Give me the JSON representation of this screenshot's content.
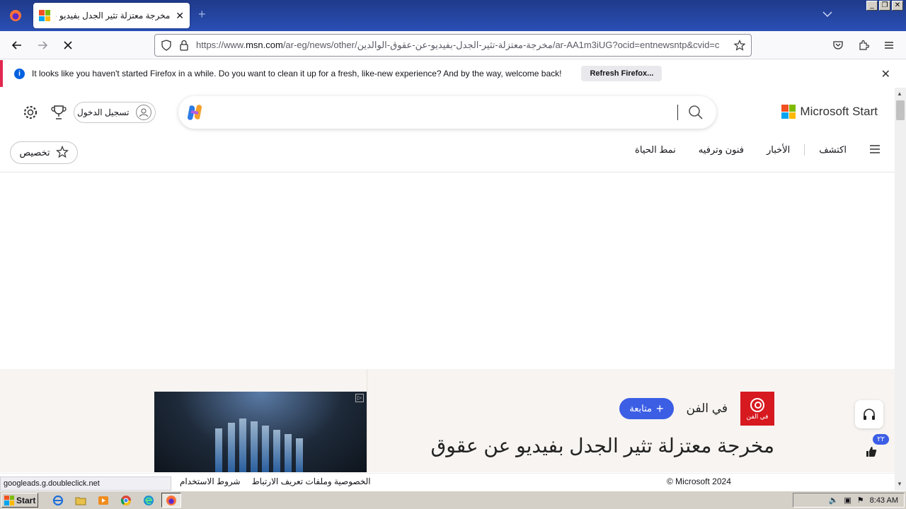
{
  "browser": {
    "tab_title": "مخرجة معتزلة تثير الجدل بفيديو عن",
    "url_prefix": "https://www.",
    "url_domain": "msn.com",
    "url_rest": "/ar-eg/news/other/مخرجة-معتزلة-تثير-الجدل-بفيديو-عن-عقوق-الوالدين/ar-AA1m3iUG?ocid=entnewsntp&cvid=c",
    "notification": {
      "message": "It looks like you haven't started Firefox in a while. Do you want to clean it up for a fresh, like-new experience? And by the way, welcome back!",
      "button": "Refresh Firefox..."
    },
    "status_url": "googleads.g.doubleclick.net"
  },
  "header": {
    "brand": "Microsoft Start",
    "signin_label": "تسجيل الدخول"
  },
  "nav": {
    "items": [
      "اكتشف",
      "الأخبار",
      "فنون وترفيه",
      "نمط الحياة"
    ],
    "customize_label": "تخصيص"
  },
  "article": {
    "publisher": "في الفن",
    "publisher_logo_text": "في الفن",
    "follow_label": "متابعة",
    "headline": "مخرجة معتزلة تثير الجدل بفيديو عن عقوق",
    "like_count": "٢٢"
  },
  "footer": {
    "links": [
      "الخصوصية وملفات تعريف الارتباط",
      "شروط الاستخدام"
    ],
    "copyright": "© Microsoft 2024"
  },
  "taskbar": {
    "start_label": "Start",
    "clock": "8:43 AM"
  },
  "colors": {
    "accent": "#3b5ee5",
    "notification_border": "#e22850",
    "publisher_red": "#d71920"
  }
}
